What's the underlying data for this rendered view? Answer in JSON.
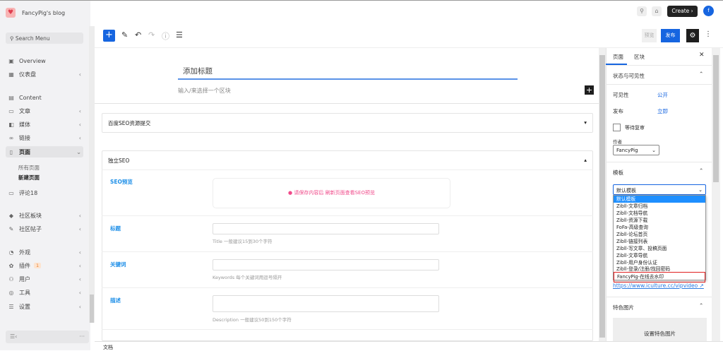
{
  "sidebar": {
    "site_name": "FancyPig's blog",
    "search_placeholder": "Search Menu",
    "items": [
      {
        "label": "Overview",
        "icon": "chart-icon"
      },
      {
        "label": "仪表盘",
        "icon": "grid-icon"
      },
      {
        "label": "Content",
        "icon": "image-icon"
      },
      {
        "label": "文章",
        "icon": "post-icon"
      },
      {
        "label": "媒体",
        "icon": "media-icon"
      },
      {
        "label": "链接",
        "icon": "link-icon"
      },
      {
        "label": "页面",
        "icon": "page-icon"
      },
      {
        "label": "评论18",
        "icon": "comment-icon"
      },
      {
        "label": "社区板块",
        "icon": "forum-icon"
      },
      {
        "label": "社区帖子",
        "icon": "topic-icon"
      },
      {
        "label": "外观",
        "icon": "palette-icon"
      },
      {
        "label": "插件",
        "icon": "plugin-icon",
        "badge": "1"
      },
      {
        "label": "用户",
        "icon": "users-icon"
      },
      {
        "label": "工具",
        "icon": "tools-icon"
      },
      {
        "label": "设置",
        "icon": "settings-icon"
      }
    ],
    "subitems": [
      "所有页面",
      "新建页面"
    ]
  },
  "topbar": {
    "create_label": "Create",
    "avatar": "f"
  },
  "toolbar": {
    "preview": "预览",
    "publish": "发布"
  },
  "editor": {
    "title_placeholder": "添加标题",
    "block_hint": "输入/来选择一个区块"
  },
  "panels": {
    "baidu": "百度SEO资源提交",
    "seo": "独立SEO",
    "seo_preview_label": "SEO预览",
    "seo_preview_msg": "请保存内容后 刷新页面查看SEO预览",
    "title_label": "标题",
    "title_help": "Title 一般建议15到30个字符",
    "keywords_label": "关键词",
    "keywords_help": "Keywords 每个关键词用逗号隔开",
    "desc_label": "描述",
    "desc_help": "Description 一般建议50到150个字符"
  },
  "right": {
    "tab_page": "页面",
    "tab_block": "区块",
    "status_title": "状态与可见性",
    "visibility_label": "可见性",
    "visibility_value": "公开",
    "publish_label": "发布",
    "publish_value": "立即",
    "pending_label": "等待复审",
    "author_label": "作者",
    "author_value": "FancyPig",
    "template_title": "模板",
    "template_value": "默认模板",
    "template_options": [
      "默认模板",
      "Zibll-文章归档",
      "Zibll-文档导航",
      "Zibll-资源下载",
      "FoFa-高级查询",
      "Zibll-论坛首页",
      "Zibll-链接列表",
      "Zibll-写文章、投稿页面",
      "Zibll-文章导航",
      "Zibll-用户身份认证",
      "Zibll-登录/注册/找回密码",
      "FancyPig-在线去水印"
    ],
    "link": "https://www.iculture.cc/vipvideo",
    "featured_title": "特色图片",
    "featured_button": "设置特色图片"
  },
  "footer": {
    "label": "文档"
  },
  "colors": {
    "accent": "#1665e0",
    "highlight": "#e02020",
    "seo_label": "#2090e8",
    "warning": "#f04a8a"
  }
}
